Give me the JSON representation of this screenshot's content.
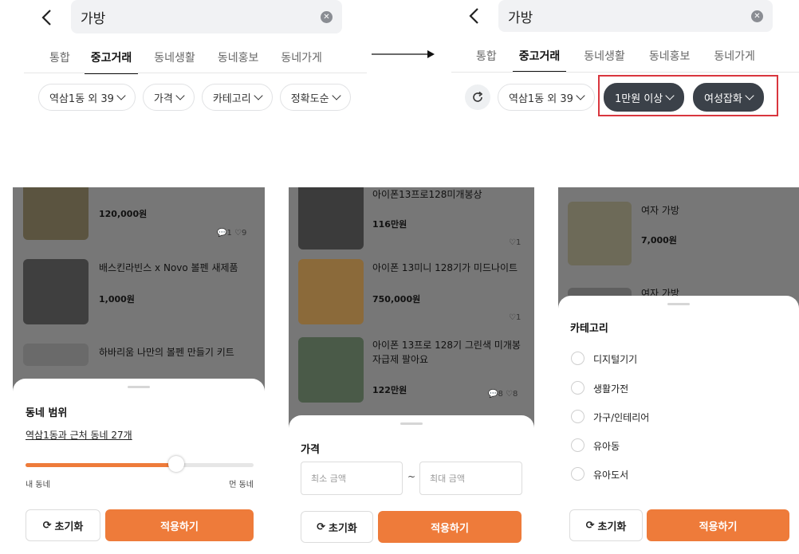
{
  "search": {
    "query": "가방"
  },
  "tabs": [
    "통합",
    "중고거래",
    "동네생활",
    "동네홍보",
    "동네가게"
  ],
  "before_filters": [
    "역삼1동 외 39",
    "가격",
    "카테고리",
    "정확도순"
  ],
  "after_filters": {
    "location": "역삼1동 외 39",
    "price": "1만원 이상",
    "category": "여성잡화"
  },
  "screen1": {
    "items": [
      {
        "title": "",
        "price": "120,000원",
        "comments": "1",
        "likes": "9"
      },
      {
        "title": "배스킨라빈스 x Novo 볼펜 새제품",
        "price": "1,000원"
      },
      {
        "title": "하바리움 나만의 볼펜 만들기 키트"
      }
    ],
    "sheet": {
      "title": "동네 범위",
      "link": "역삼1동과 근처 동네 27개",
      "slider_fraction": 0.66,
      "left_label": "내 동네",
      "right_label": "먼 동네",
      "reset": "초기화",
      "apply": "적용하기"
    }
  },
  "screen2": {
    "items": [
      {
        "title": "아이폰13프로128미개봉상",
        "price": "116만원",
        "likes": "1"
      },
      {
        "title": "아이폰 13미니 128기가 미드나이트",
        "price": "750,000원",
        "likes": "1"
      },
      {
        "title": "아이폰 13프로 128기 그린색 미개봉",
        "title2": "자급제 팔아요",
        "price": "122만원",
        "comments": "8",
        "likes": "8"
      }
    ],
    "sheet": {
      "title": "가격",
      "min_placeholder": "최소 금액",
      "tilde": "~",
      "max_placeholder": "최대 금액",
      "reset": "초기화",
      "apply": "적용하기"
    }
  },
  "screen3": {
    "items": [
      {
        "title": "여자 가방",
        "price": "7,000원"
      },
      {
        "title": "여자 가방"
      }
    ],
    "sheet": {
      "title": "카테고리",
      "options": [
        "디지털기기",
        "생활가전",
        "가구/인테리어",
        "유아동",
        "유아도서"
      ],
      "reset": "초기화",
      "apply": "적용하기"
    }
  },
  "colors": {
    "accent": "#ee7b3a",
    "dark_chip": "#3b4149",
    "highlight": "#d9363e"
  }
}
